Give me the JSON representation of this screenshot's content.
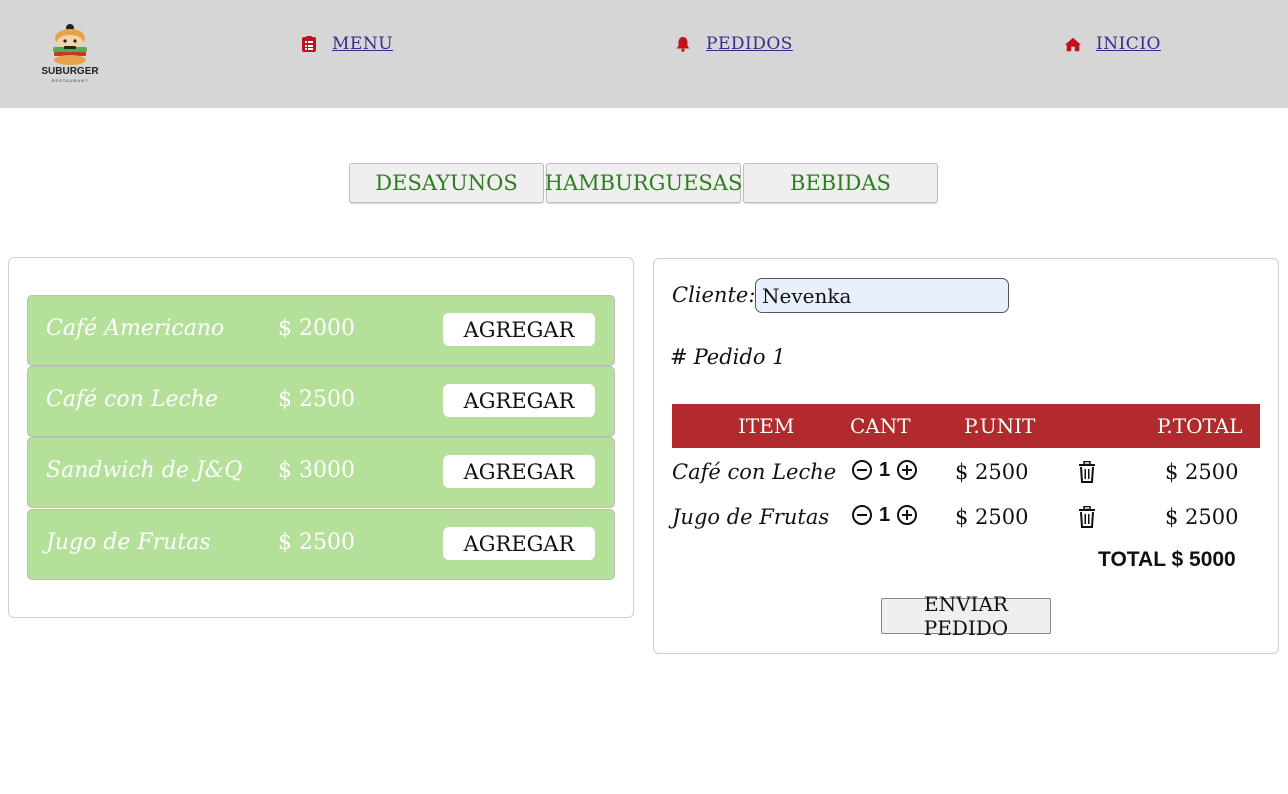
{
  "brand": {
    "name": "SUBURGER",
    "tagline": "RESTAURANT"
  },
  "nav": {
    "menu": {
      "label": "MENU",
      "icon": "list-icon"
    },
    "pedidos": {
      "label": "PEDIDOS",
      "icon": "bell-icon"
    },
    "inicio": {
      "label": "INICIO",
      "icon": "home-icon"
    }
  },
  "tabs": [
    "DESAYUNOS",
    "HAMBURGUESAS",
    "BEBIDAS"
  ],
  "products": [
    {
      "name": "Café Americano",
      "price": "$ 2000",
      "action": "AGREGAR"
    },
    {
      "name": "Café con Leche",
      "price": "$ 2500",
      "action": "AGREGAR"
    },
    {
      "name": "Sandwich de J&Q",
      "price": "$ 3000",
      "action": "AGREGAR"
    },
    {
      "name": "Jugo de Frutas",
      "price": "$ 2500",
      "action": "AGREGAR"
    }
  ],
  "order": {
    "cliente_label": "Cliente:",
    "cliente_value": "Nevenka",
    "pedido_hash": "#",
    "pedido_label": "Pedido 1",
    "headers": {
      "item": "ITEM",
      "cant": "CANT",
      "punit": "P.UNIT",
      "ptotal": "P.TOTAL"
    },
    "rows": [
      {
        "item": "Café con Leche",
        "qty": "1",
        "punit": "$ 2500",
        "ptotal": "$ 2500"
      },
      {
        "item": "Jugo de Frutas",
        "qty": "1",
        "punit": "$ 2500",
        "ptotal": "$ 2500"
      }
    ],
    "total": "TOTAL $ 5000",
    "submit": "ENVIAR PEDIDO"
  },
  "colors": {
    "header_bg": "#d6d6d6",
    "tab_text": "#2e7d1f",
    "product_bg": "#b4e09a",
    "table_head": "#b02a2e",
    "nav_icon": "#c0121a",
    "link": "#3a2a8c"
  }
}
